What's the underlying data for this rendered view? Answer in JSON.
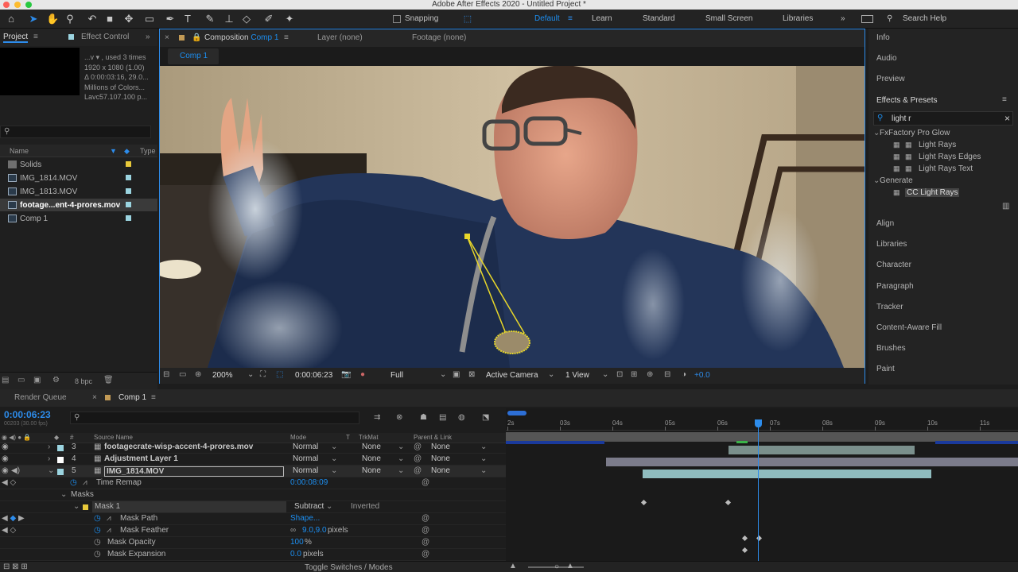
{
  "window": {
    "title": "Adobe After Effects 2020 - Untitled Project *"
  },
  "toolbar": {
    "snapping_label": "Snapping",
    "workspaces": [
      "Default",
      "Learn",
      "Standard",
      "Small Screen",
      "Libraries"
    ],
    "active_workspace": "Default",
    "search_label": "Search Help"
  },
  "project": {
    "tab_project": "Project",
    "tab_effect": "Effect Control",
    "info": [
      "...v ▾ , used 3 times",
      "1920 x 1080 (1.00)",
      "Δ 0:00:03:16, 29.0...",
      "Millions of Colors...",
      "Lavc57.107.100 p..."
    ],
    "col_name": "Name",
    "col_type": "Type",
    "items": [
      {
        "name": "Solids",
        "color": "#e8c93a",
        "kind": "folder"
      },
      {
        "name": "IMG_1814.MOV",
        "color": "#9bd4e0",
        "kind": "file"
      },
      {
        "name": "IMG_1813.MOV",
        "color": "#9bd4e0",
        "kind": "file"
      },
      {
        "name": "footage...ent-4-prores.mov",
        "color": "#9bd4e0",
        "kind": "file",
        "selected": true
      },
      {
        "name": "Comp 1",
        "color": "#9bd4e0",
        "kind": "comp"
      }
    ],
    "bpc": "8 bpc"
  },
  "viewer": {
    "tab_comp_prefix": "Composition",
    "tab_comp_name": "Comp 1",
    "tab_layer": "Layer (none)",
    "tab_footage": "Footage (none)",
    "crumb": "Comp 1",
    "zoom": "200%",
    "timecode": "0:00:06:23",
    "resolution": "Full",
    "camera": "Active Camera",
    "views": "1 View",
    "exposure": "+0.0"
  },
  "right": {
    "panels_top": [
      "Info",
      "Audio",
      "Preview"
    ],
    "effects_title": "Effects & Presets",
    "search_value": "light r",
    "groups": [
      {
        "name": "FxFactory Pro Glow",
        "items": [
          "Light Rays",
          "Light Rays Edges",
          "Light Rays Text"
        ]
      },
      {
        "name": "Generate",
        "items": [
          "CC Light Rays"
        ]
      }
    ],
    "panels_bottom": [
      "Align",
      "Libraries",
      "Character",
      "Paragraph",
      "Tracker",
      "Content-Aware Fill",
      "Brushes",
      "Paint"
    ]
  },
  "timeline": {
    "tab_render": "Render Queue",
    "tab_comp": "Comp 1",
    "timecode": "0:00:06:23",
    "timecode_sub": "00203 (30.00 fps)",
    "col_num": "#",
    "col_source": "Source Name",
    "col_mode": "Mode",
    "col_t": "T",
    "col_trkmat": "TrkMat",
    "col_parent": "Parent & Link",
    "ruler": [
      "2s",
      "03s",
      "04s",
      "05s",
      "06s",
      "07s",
      "08s",
      "09s",
      "10s",
      "11s"
    ],
    "layers": [
      {
        "num": "3",
        "name": "footagecrate-wisp-accent-4-prores.mov",
        "color": "#9bd4e0",
        "mode": "Normal",
        "trkmat": "None",
        "parent": "None"
      },
      {
        "num": "4",
        "name": "Adjustment Layer 1",
        "color": "#ffffff",
        "mode": "Normal",
        "trkmat": "None",
        "parent": "None"
      },
      {
        "num": "5",
        "name": "IMG_1814.MOV",
        "color": "#9bd4e0",
        "mode": "Normal",
        "trkmat": "None",
        "parent": "None"
      }
    ],
    "props": {
      "time_remap": "Time Remap",
      "time_remap_val": "0:00:08:09",
      "masks": "Masks",
      "mask1": "Mask 1",
      "mask_mode": "Subtract",
      "inverted": "Inverted",
      "mask_path": "Mask Path",
      "mask_path_val": "Shape...",
      "mask_feather": "Mask Feather",
      "mask_feather_val": "9.0,9.0",
      "mask_feather_unit": "pixels",
      "mask_opacity": "Mask Opacity",
      "mask_opacity_val": "100",
      "mask_opacity_unit": "%",
      "mask_expansion": "Mask Expansion",
      "mask_expansion_val": "0.0",
      "mask_expansion_unit": "pixels"
    },
    "toggle_label": "Toggle Switches / Modes"
  }
}
